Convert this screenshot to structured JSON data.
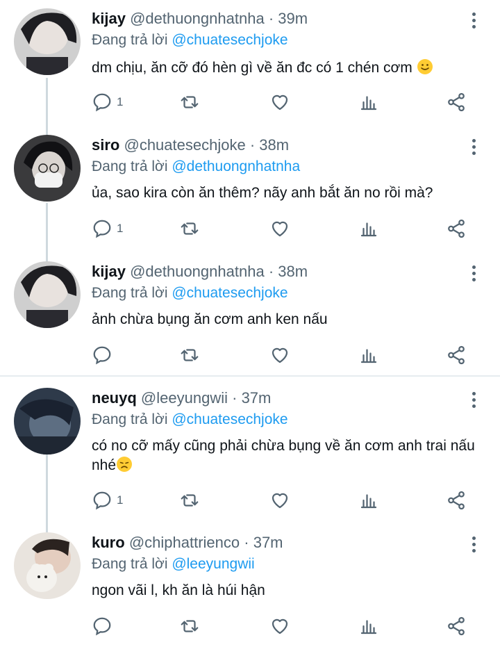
{
  "reply_prefix": "Đang trả lời",
  "tweets": [
    {
      "name": "kijay",
      "handle": "@dethuongnhatnha",
      "time": "39m",
      "reply_to": "@chuatesechjoke",
      "text": "dm chịu, ăn cỡ đó hèn gì về ăn đc có 1 chén cơm",
      "emoji": "slightly-smiling-face",
      "reply_count": "1"
    },
    {
      "name": "siro",
      "handle": "@chuatesechjoke",
      "time": "38m",
      "reply_to": "@dethuongnhatnha",
      "text": "ủa, sao kira còn ăn thêm? nãy anh bắt ăn no rồi mà?",
      "reply_count": "1"
    },
    {
      "name": "kijay",
      "handle": "@dethuongnhatnha",
      "time": "38m",
      "reply_to": "@chuatesechjoke",
      "text": "ảnh chừa bụng ăn cơm anh ken nấu",
      "reply_count": ""
    },
    {
      "name": "neuyq",
      "handle": "@leeyungwii",
      "time": "37m",
      "reply_to": "@chuatesechjoke",
      "text": "có no cỡ mấy cũng phải chừa bụng về ăn cơm anh trai nấu nhé",
      "emoji": "disappointed-face",
      "reply_count": "1"
    },
    {
      "name": "kuro",
      "handle": "@chiphattrienco",
      "time": "37m",
      "reply_to": "@leeyungwii",
      "text": "ngon vãi l, kh ăn là húi hận",
      "reply_count": ""
    }
  ],
  "colors": {
    "link": "#1d9bf0",
    "muted": "#536471",
    "text": "#0f1419",
    "thread_line": "#cfd9de"
  }
}
